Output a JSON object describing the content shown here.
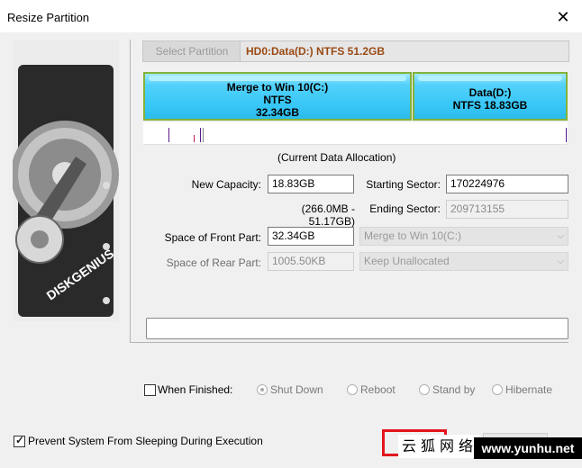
{
  "window": {
    "title": "Resize Partition",
    "close_glyph": "✕"
  },
  "image_panel": {
    "brand": "DISKGENIUS"
  },
  "top_bar": {
    "select_partition_label": "Select Partition",
    "disk_label": "HD0:Data(D:) NTFS 51.2GB"
  },
  "partitions": [
    {
      "name": "Merge to Win 10(C:)",
      "fs": "NTFS",
      "size": "32.34GB"
    },
    {
      "name": "Data(D:)",
      "fs": "NTFS 18.83GB"
    }
  ],
  "allocation_caption": "(Current Data Allocation)",
  "form": {
    "new_capacity_label": "New Capacity:",
    "new_capacity_value": "18.83GB",
    "capacity_range": "(266.0MB - 51.17GB)",
    "starting_sector_label": "Starting Sector:",
    "starting_sector_value": "170224976",
    "ending_sector_label": "Ending Sector:",
    "ending_sector_value": "209713155",
    "front_part_label": "Space of Front Part:",
    "front_part_value": "32.34GB",
    "front_part_action": "Merge to Win 10(C:)",
    "rear_part_label": "Space of Rear Part:",
    "rear_part_value": "1005.50KB",
    "rear_part_action": "Keep Unallocated"
  },
  "when_finished": {
    "label": "When Finished:",
    "options": [
      "Shut Down",
      "Reboot",
      "Stand by",
      "Hibernate"
    ]
  },
  "prevent_sleep_label": "Prevent System From Sleeping During Execution",
  "watermark": {
    "cn": "云狐网络",
    "en": "www.yunhu.net"
  },
  "colors": {
    "partition_fill": "#38c7f7",
    "partition_border": "#84b23b",
    "disk_label": "#9b4a14",
    "highlight": "#e2151b"
  }
}
